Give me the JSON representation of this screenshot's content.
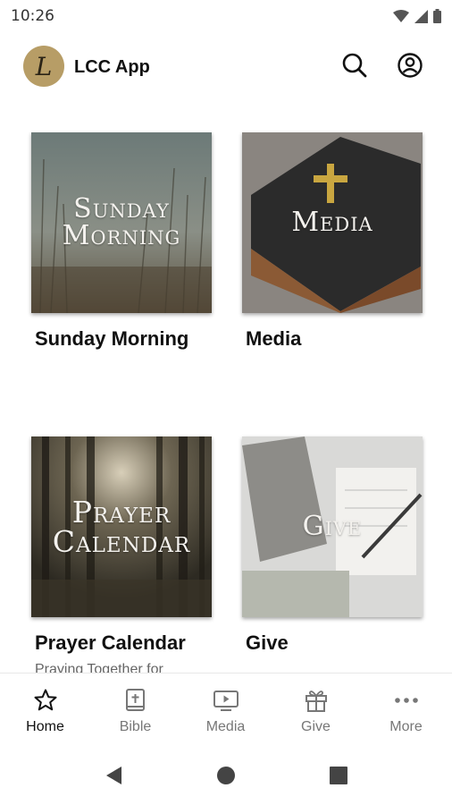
{
  "status_bar": {
    "time": "10:26"
  },
  "app_bar": {
    "logo_letter": "L",
    "title": "LCC App"
  },
  "cards": [
    {
      "label": "Sunday Morning",
      "image_text": [
        "Sunday",
        "Morning"
      ]
    },
    {
      "label": "Media",
      "image_text": [
        "Media"
      ]
    },
    {
      "label": "Prayer Calendar",
      "image_text": [
        "Prayer",
        "Calendar"
      ],
      "sublabel": "Praying Together for"
    },
    {
      "label": "Give",
      "image_text": [
        "Give"
      ]
    }
  ],
  "bottom_nav": [
    {
      "label": "Home",
      "icon": "star-icon",
      "active": true
    },
    {
      "label": "Bible",
      "icon": "bible-icon",
      "active": false
    },
    {
      "label": "Media",
      "icon": "media-icon",
      "active": false
    },
    {
      "label": "Give",
      "icon": "gift-icon",
      "active": false
    },
    {
      "label": "More",
      "icon": "more-icon",
      "active": false
    }
  ],
  "colors": {
    "logo_bg": "#b79d66",
    "active": "#111111",
    "inactive": "#777777"
  }
}
